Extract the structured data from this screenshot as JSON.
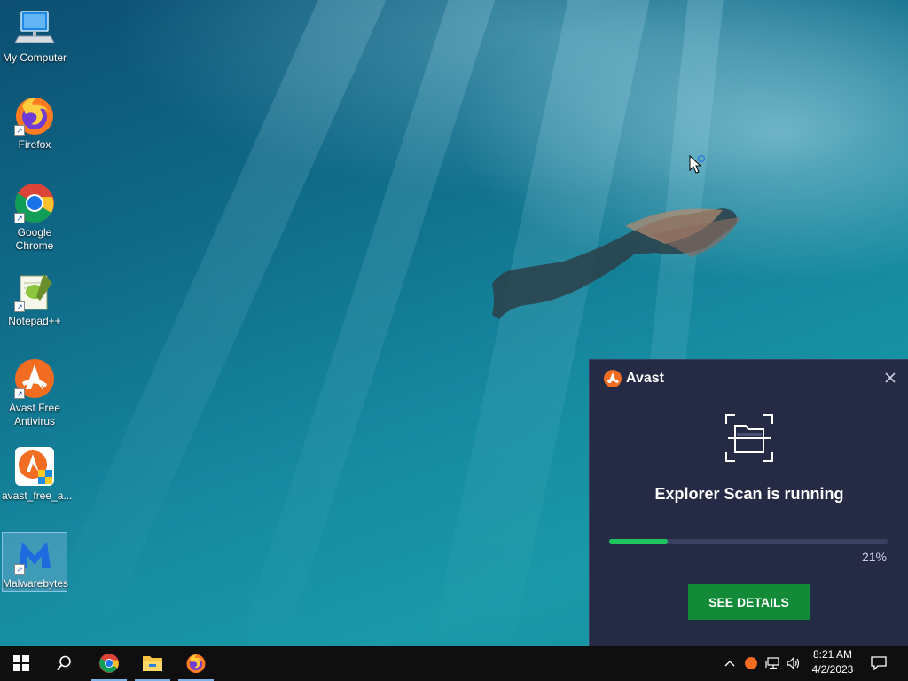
{
  "desktop": {
    "icons": [
      {
        "label": "My Computer"
      },
      {
        "label": "Firefox"
      },
      {
        "label": "Google Chrome"
      },
      {
        "label": "Notepad++"
      },
      {
        "label": "Avast Free Antivirus"
      },
      {
        "label": "avast_free_a..."
      },
      {
        "label": "Malwarebytes"
      }
    ]
  },
  "avast_popup": {
    "brand": "Avast",
    "title": "Explorer Scan is running",
    "progress_percent": 21,
    "progress_label": "21%",
    "details_button": "SEE DETAILS",
    "colors": {
      "background": "#252a45",
      "progress": "#1ec45d",
      "button": "#128a37",
      "brand_orange": "#f26c22"
    }
  },
  "taskbar": {
    "pinned": [
      "start-icon",
      "search-icon",
      "chrome-icon",
      "file-explorer-icon",
      "firefox-icon"
    ],
    "tray": {
      "time": "8:21 AM",
      "date": "4/2/2023"
    }
  }
}
